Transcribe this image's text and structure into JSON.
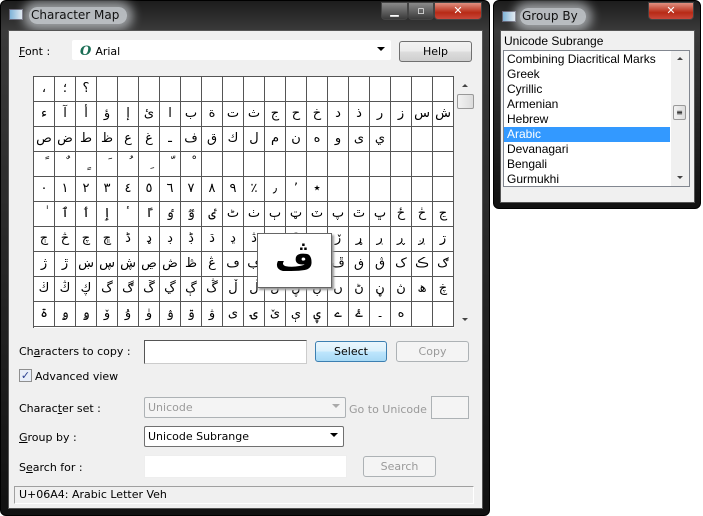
{
  "charmap": {
    "title": "Character Map",
    "font_label": "Font :",
    "font_value": "Arial",
    "font_icon": "opentype-font-icon",
    "help_button": "Help",
    "grid_rows": [
      "،؛؟",
      "ءآأؤإئابةتثجحخدذرزسش",
      "صضطظعغـفقكلمنهوىي",
      "ًٌٍَُِّْ",
      "٠١٢٣٤٥٦٧٨٩٪٫٬٭",
      "ٰٱٲٳٴٵٶٷٸٹٺٻټٽپٿڀځڂڃ",
      "ڄڅچڇڈډڊڋڌڍڎڏڐڑڒړڔڕږڗ",
      "ژڙښڛڜڝڞڟڠڡڢڣڤڥڦڧڨکڪګ",
      "ڬڭڮگڰڱڲڳڴڵڶڷڸڹںڻڼڽھڿ",
      "ۃۄۅۆۇۈۉۊۋیۍێېۑےۓ۔ە"
    ],
    "magnified_char": "ڤ",
    "chars_to_copy_label": "Characters to copy :",
    "chars_to_copy_value": "",
    "select_button": "Select",
    "copy_button": "Copy",
    "advanced_view_label": "Advanced view",
    "advanced_view_checked": true,
    "character_set_label": "Character set :",
    "character_set_value": "Unicode",
    "go_to_unicode_label": "Go to Unicode :",
    "go_to_unicode_value": "",
    "group_by_label": "Group by :",
    "group_by_value": "Unicode Subrange",
    "search_label": "Search for :",
    "search_value": "",
    "search_button": "Search",
    "status": "U+06A4: Arabic Letter Veh"
  },
  "groupby": {
    "title": "Group By",
    "header": "Unicode Subrange",
    "items": [
      "Combining Diacritical Marks",
      "Greek",
      "Cyrillic",
      "Armenian",
      "Hebrew",
      "Arabic",
      "Devanagari",
      "Bengali",
      "Gurmukhi"
    ],
    "selected": "Arabic",
    "selection_color": "#3399ff"
  }
}
